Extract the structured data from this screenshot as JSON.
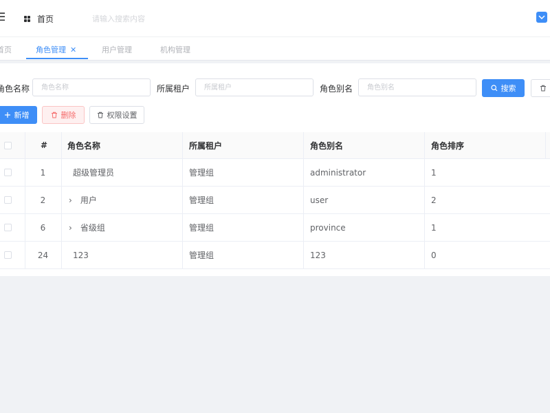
{
  "header": {
    "home_label": "首页",
    "search_placeholder": "请输入搜索内容"
  },
  "tabs": [
    {
      "label": "首页",
      "active": false
    },
    {
      "label": "角色管理",
      "active": true
    },
    {
      "label": "用户管理",
      "active": false
    },
    {
      "label": "机构管理",
      "active": false
    }
  ],
  "filters": {
    "role_name": {
      "label": "角色名称",
      "placeholder": "角色名称",
      "value": ""
    },
    "tenant": {
      "label": "所属租户",
      "placeholder": "所属租户",
      "value": ""
    },
    "role_alias": {
      "label": "角色别名",
      "placeholder": "角色别名",
      "value": ""
    },
    "search_label": "搜索"
  },
  "toolbar": {
    "add_label": "新增",
    "delete_label": "删除",
    "permission_label": "权限设置"
  },
  "table": {
    "columns": [
      "#",
      "角色名称",
      "所属租户",
      "角色别名",
      "角色排序"
    ],
    "rows": [
      {
        "index": "1",
        "name": "超级管理员",
        "tenant": "管理组",
        "alias": "administrator",
        "sort": "1",
        "expandable": false
      },
      {
        "index": "2",
        "name": "用户",
        "tenant": "管理组",
        "alias": "user",
        "sort": "2",
        "expandable": true
      },
      {
        "index": "6",
        "name": "省级组",
        "tenant": "管理组",
        "alias": "province",
        "sort": "1",
        "expandable": true
      },
      {
        "index": "24",
        "name": "123",
        "tenant": "管理组",
        "alias": "123",
        "sort": "0",
        "expandable": false
      }
    ]
  },
  "colors": {
    "primary": "#3e8ef7",
    "danger": "#f56c6c",
    "background": "#f0f2f5"
  }
}
